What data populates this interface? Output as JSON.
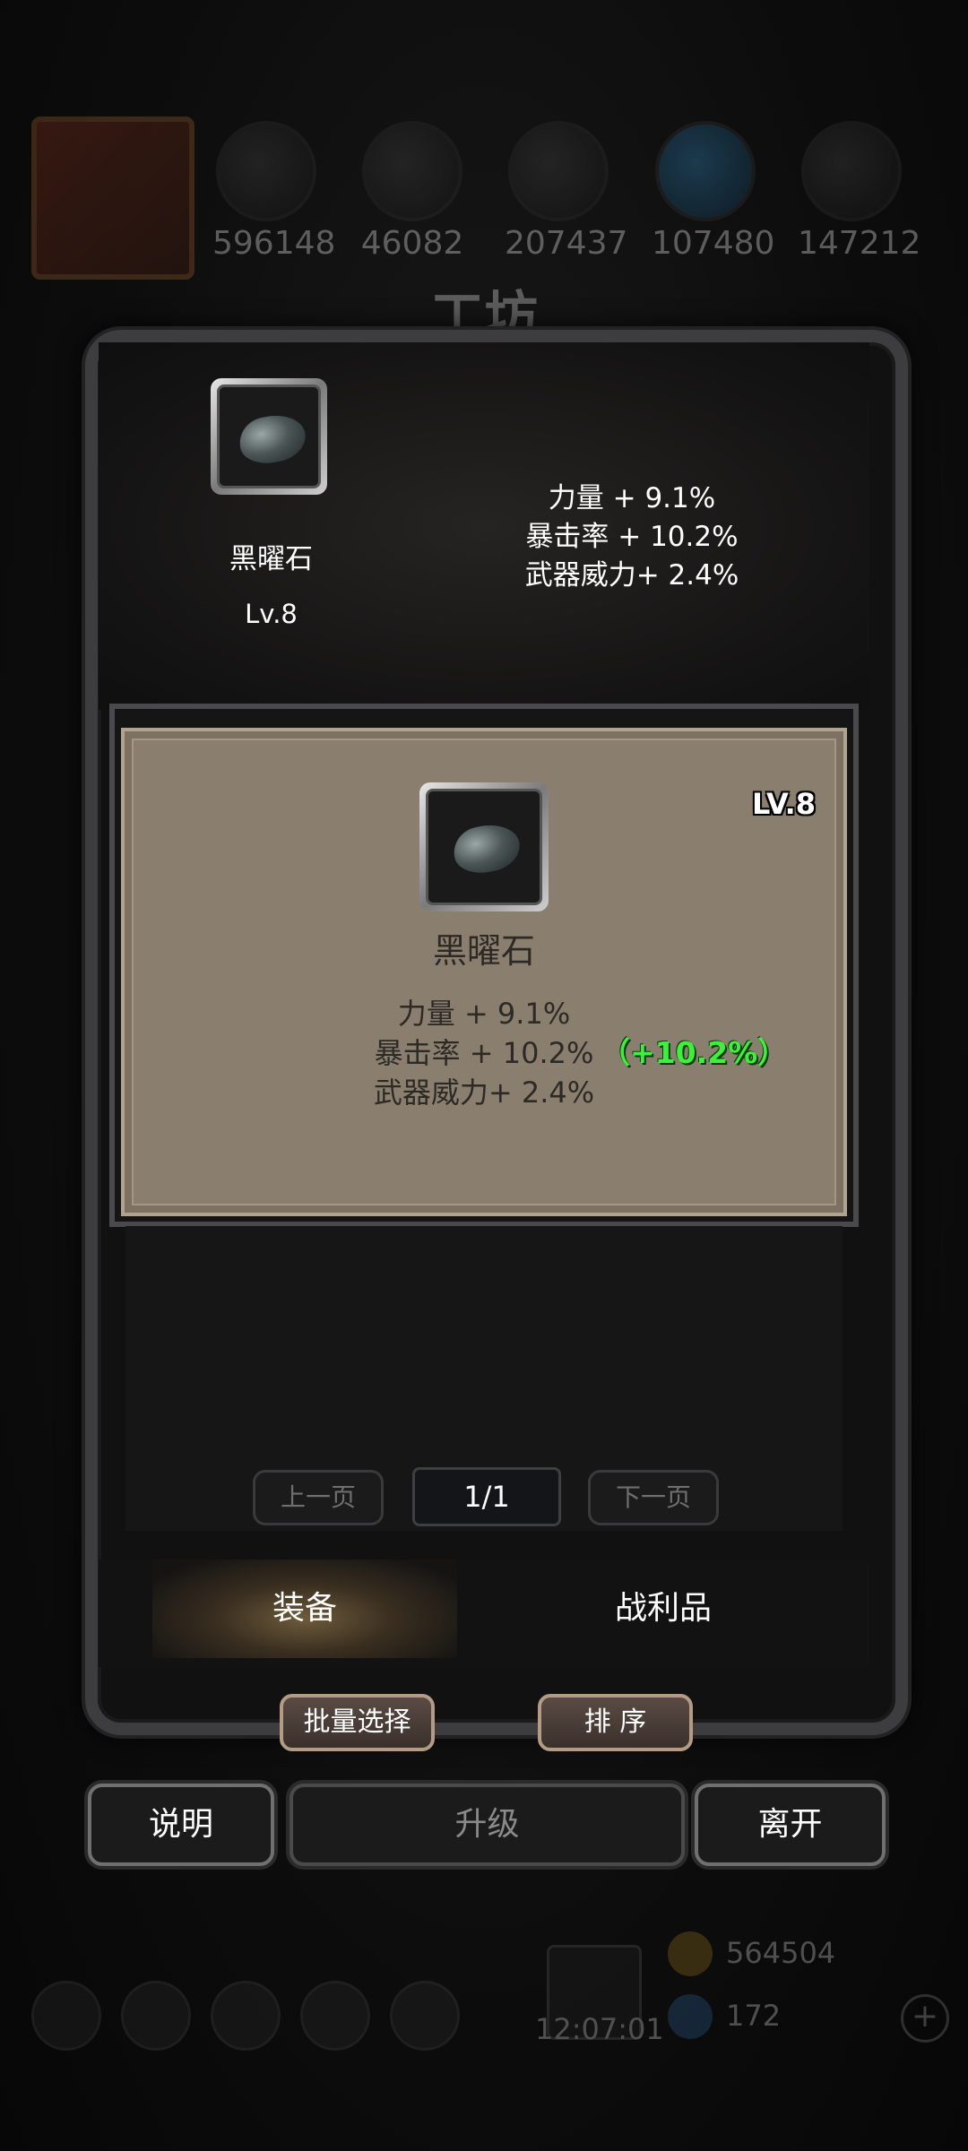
{
  "resources": {
    "values": [
      "596148",
      "46082",
      "207437",
      "107480",
      "147212"
    ],
    "icons": [
      "portrait-icon",
      "meat-icon",
      "wood-icon",
      "stone-icon",
      "water-icon",
      "iron-icon"
    ]
  },
  "background_title": "工坊",
  "top_item": {
    "name": "黑曜石",
    "level": "Lv.8",
    "stats": [
      "力量 + 9.1%",
      "暴击率 + 10.2%",
      "武器威力+ 2.4%"
    ]
  },
  "card": {
    "level_badge": "LV.8",
    "name": "黑曜石",
    "stats": [
      "力量 + 9.1%",
      "暴击率 + 10.2%",
      "武器威力+ 2.4%"
    ],
    "bonus": "（+10.2%）"
  },
  "pager": {
    "prev": "上一页",
    "indicator": "1/1",
    "next": "下一页"
  },
  "tabs": {
    "equipment": "装备",
    "loot": "战利品"
  },
  "actions": {
    "batch_select": "批量选择",
    "sort": "排 序",
    "help": "说明",
    "upgrade": "升级",
    "leave": "离开"
  },
  "bottom": {
    "gold": "564504",
    "gems": "172",
    "timer": "12:07:01"
  },
  "colors": {
    "bonus_green": "#3cf03c",
    "card_bg": "#8a7f6f"
  }
}
